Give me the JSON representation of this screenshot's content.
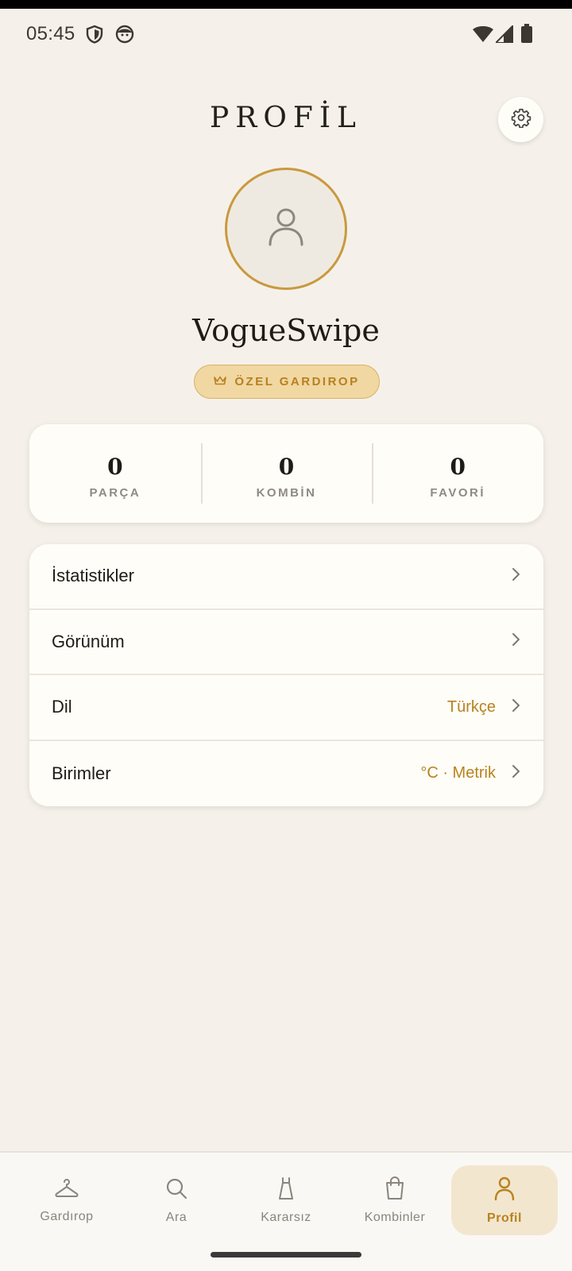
{
  "status_bar": {
    "time": "05:45"
  },
  "header": {
    "title": "PROFİL"
  },
  "profile": {
    "username": "VogueSwipe",
    "badge_label": "ÖZEL GARDIROP"
  },
  "stats": [
    {
      "value": "0",
      "label": "PARÇA"
    },
    {
      "value": "0",
      "label": "KOMBİN"
    },
    {
      "value": "0",
      "label": "FAVORİ"
    }
  ],
  "menu": [
    {
      "label": "İstatistikler",
      "value": ""
    },
    {
      "label": "Görünüm",
      "value": ""
    },
    {
      "label": "Dil",
      "value": "Türkçe"
    },
    {
      "label": "Birimler",
      "value": "°C · Metrik"
    }
  ],
  "bottom_nav": [
    {
      "label": "Gardırop",
      "icon": "hanger-icon"
    },
    {
      "label": "Ara",
      "icon": "search-icon"
    },
    {
      "label": "Kararsız",
      "icon": "dress-icon"
    },
    {
      "label": "Kombinler",
      "icon": "shopping-bag-icon"
    },
    {
      "label": "Profil",
      "icon": "person-icon",
      "active": true
    }
  ],
  "colors": {
    "background": "#f5f1ea",
    "accent": "#b7831f",
    "avatar_ring": "#c9993f",
    "badge_bg": "#f1d7a1"
  }
}
